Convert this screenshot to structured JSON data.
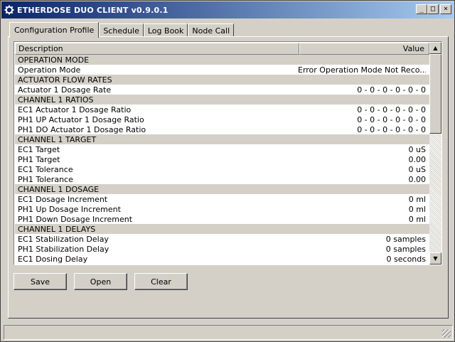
{
  "window": {
    "title": "ETHERDOSE DUO CLIENT v0.9.0.1",
    "icon": "gear-icon",
    "minimize_glyph": "_",
    "maximize_glyph": "□",
    "close_glyph": "×"
  },
  "tabs": [
    {
      "label": "Configuration Profile",
      "active": true
    },
    {
      "label": "Schedule",
      "active": false
    },
    {
      "label": "Log Book",
      "active": false
    },
    {
      "label": "Node Call",
      "active": false
    }
  ],
  "grid": {
    "columns": {
      "description": "Description",
      "value": "Value"
    },
    "rows": [
      {
        "type": "section",
        "label": "OPERATION MODE"
      },
      {
        "type": "item",
        "label": "Operation Mode",
        "value": "Error Operation Mode Not Reco..."
      },
      {
        "type": "section",
        "label": "ACTUATOR FLOW RATES"
      },
      {
        "type": "item",
        "label": "Actuator 1 Dosage Rate",
        "value": "0 - 0 - 0 - 0 - 0 - 0"
      },
      {
        "type": "section",
        "label": "CHANNEL 1 RATIOS"
      },
      {
        "type": "item",
        "label": "EC1 Actuator 1 Dosage Ratio",
        "value": "0 - 0 - 0 - 0 - 0 - 0"
      },
      {
        "type": "item",
        "label": "PH1 UP Actuator 1 Dosage Ratio",
        "value": "0 - 0 - 0 - 0 - 0 - 0"
      },
      {
        "type": "item",
        "label": "PH1 DO Actuator 1 Dosage Ratio",
        "value": "0 - 0 - 0 - 0 - 0 - 0"
      },
      {
        "type": "section",
        "label": "CHANNEL 1 TARGET"
      },
      {
        "type": "item",
        "label": "EC1 Target",
        "value": "0 uS"
      },
      {
        "type": "item",
        "label": "PH1 Target",
        "value": "0.00"
      },
      {
        "type": "item",
        "label": "EC1 Tolerance",
        "value": "0 uS"
      },
      {
        "type": "item",
        "label": "PH1 Tolerance",
        "value": "0.00"
      },
      {
        "type": "section",
        "label": "CHANNEL 1 DOSAGE"
      },
      {
        "type": "item",
        "label": "EC1 Dosage Increment",
        "value": "0 ml"
      },
      {
        "type": "item",
        "label": "PH1 Up Dosage Increment",
        "value": "0 ml"
      },
      {
        "type": "item",
        "label": "PH1 Down Dosage Increment",
        "value": "0 ml"
      },
      {
        "type": "section",
        "label": "CHANNEL 1 DELAYS"
      },
      {
        "type": "item",
        "label": "EC1 Stabilization Delay",
        "value": "0 samples"
      },
      {
        "type": "item",
        "label": "PH1 Stabilization Delay",
        "value": "0 samples"
      },
      {
        "type": "item",
        "label": "EC1 Dosing Delay",
        "value": "0 seconds"
      }
    ]
  },
  "buttons": {
    "save": "Save",
    "open": "Open",
    "clear": "Clear"
  },
  "scrollbar": {
    "up_glyph": "▲",
    "down_glyph": "▼"
  }
}
